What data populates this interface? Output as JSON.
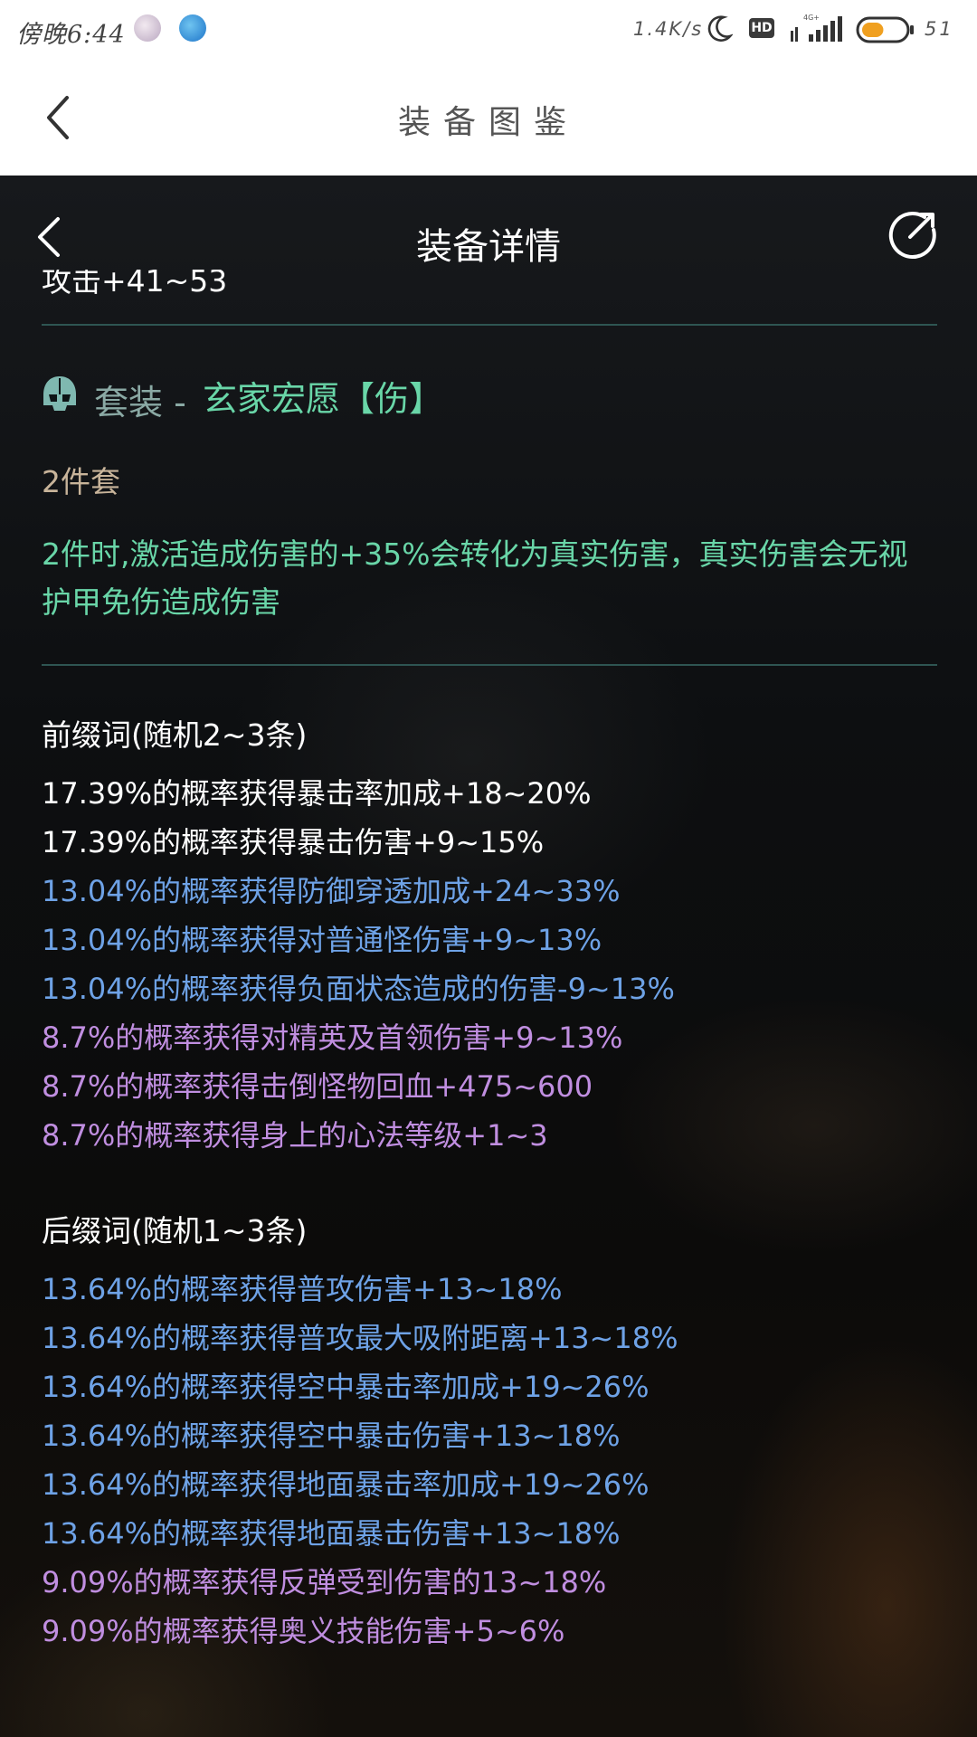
{
  "status_bar": {
    "time": "傍晚6:44",
    "net_speed": "1.4K/s",
    "hd_label": "HD",
    "battery_percent": "51",
    "battery_level": 0.51,
    "signal_label": "4G+",
    "icons": [
      "app-notification-icon",
      "app-notification-icon",
      "moon-icon",
      "signal-icon",
      "battery-icon"
    ]
  },
  "app_header": {
    "title": "装备图鉴",
    "back_icon": "chevron-left-icon"
  },
  "detail": {
    "title": "装备详情",
    "back_icon": "chevron-left-icon",
    "share_icon": "share-icon",
    "cut_line": "攻击+41~53",
    "set": {
      "icon": "helmet-icon",
      "label": "套装 - ",
      "name": "玄家宏愿【伤】",
      "pieces": "2件套",
      "effect": "2件时,激活造成伤害的+35%会转化为真实伤害，真实伤害会无视护甲免伤造成伤害"
    },
    "prefix": {
      "title": "前缀词(随机2~3条)",
      "items": [
        {
          "text": "17.39%的概率获得暴击率加成+18~20%",
          "tier": "white"
        },
        {
          "text": "17.39%的概率获得暴击伤害+9~15%",
          "tier": "white"
        },
        {
          "text": "13.04%的概率获得防御穿透加成+24~33%",
          "tier": "blue"
        },
        {
          "text": "13.04%的概率获得对普通怪伤害+9~13%",
          "tier": "blue"
        },
        {
          "text": "13.04%的概率获得负面状态造成的伤害-9~13%",
          "tier": "blue"
        },
        {
          "text": "8.7%的概率获得对精英及首领伤害+9~13%",
          "tier": "purple"
        },
        {
          "text": "8.7%的概率获得击倒怪物回血+475~600",
          "tier": "purple"
        },
        {
          "text": "8.7%的概率获得身上的心法等级+1~3",
          "tier": "purple"
        }
      ]
    },
    "suffix": {
      "title": "后缀词(随机1~3条)",
      "items": [
        {
          "text": "13.64%的概率获得普攻伤害+13~18%",
          "tier": "blue"
        },
        {
          "text": "13.64%的概率获得普攻最大吸附距离+13~18%",
          "tier": "blue"
        },
        {
          "text": "13.64%的概率获得空中暴击率加成+19~26%",
          "tier": "blue"
        },
        {
          "text": "13.64%的概率获得空中暴击伤害+13~18%",
          "tier": "blue"
        },
        {
          "text": "13.64%的概率获得地面暴击率加成+19~26%",
          "tier": "blue"
        },
        {
          "text": "13.64%的概率获得地面暴击伤害+13~18%",
          "tier": "blue"
        },
        {
          "text": "9.09%的概率获得反弹受到伤害的13~18%",
          "tier": "purple"
        },
        {
          "text": "9.09%的概率获得奥义技能伤害+5~6%",
          "tier": "purple"
        }
      ]
    }
  },
  "colors": {
    "divider": "#2e5552",
    "set_green": "#69d6a8",
    "tier_white": "#ffffff",
    "tier_blue": "#6ea2e6",
    "tier_purple": "#c08ee0",
    "pieces_tan": "#c8b49a"
  }
}
